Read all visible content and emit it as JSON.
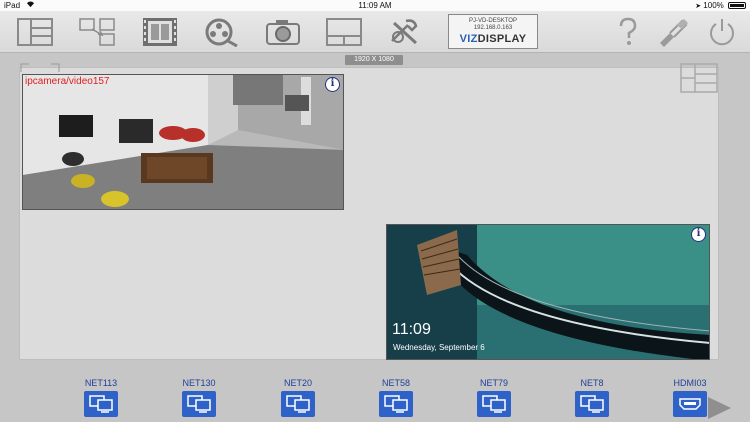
{
  "status_bar": {
    "device": "iPad",
    "time": "11:09 AM",
    "battery": "100%"
  },
  "toolbar": {
    "items": [
      {
        "name": "layout-panels-icon"
      },
      {
        "name": "arrange-windows-icon"
      },
      {
        "name": "film-strip-icon"
      },
      {
        "name": "reels-search-icon"
      },
      {
        "name": "camera-icon"
      },
      {
        "name": "split-screen-icon"
      },
      {
        "name": "tools-settings-icon"
      },
      {
        "name": "help-icon"
      },
      {
        "name": "paint-brush-icon"
      },
      {
        "name": "power-icon"
      }
    ],
    "device_box": {
      "host": "PJ-VD-DESKTOP",
      "ip": "192.168.0.163",
      "brand_a": "VIZ",
      "brand_b": "DISPLAY"
    }
  },
  "canvas": {
    "resolution": "1920 X 1080"
  },
  "windows": [
    {
      "title": "ipcamera/video157",
      "info": "i"
    },
    {
      "title": "",
      "info": "i",
      "lock_time": "11:09",
      "lock_date": "Wednesday, September 6"
    }
  ],
  "sources": [
    {
      "label": "NET113",
      "icon": "monitor-icon"
    },
    {
      "label": "NET130",
      "icon": "monitor-icon"
    },
    {
      "label": "NET20",
      "icon": "monitor-icon"
    },
    {
      "label": "NET58",
      "icon": "monitor-icon"
    },
    {
      "label": "NET79",
      "icon": "monitor-icon"
    },
    {
      "label": "NET8",
      "icon": "monitor-icon"
    },
    {
      "label": "HDMI03",
      "icon": "hdmi-icon"
    }
  ],
  "colors": {
    "accent_blue": "#2f62c9",
    "label_blue": "#1f3f9a",
    "window_title_red": "#e02020"
  }
}
